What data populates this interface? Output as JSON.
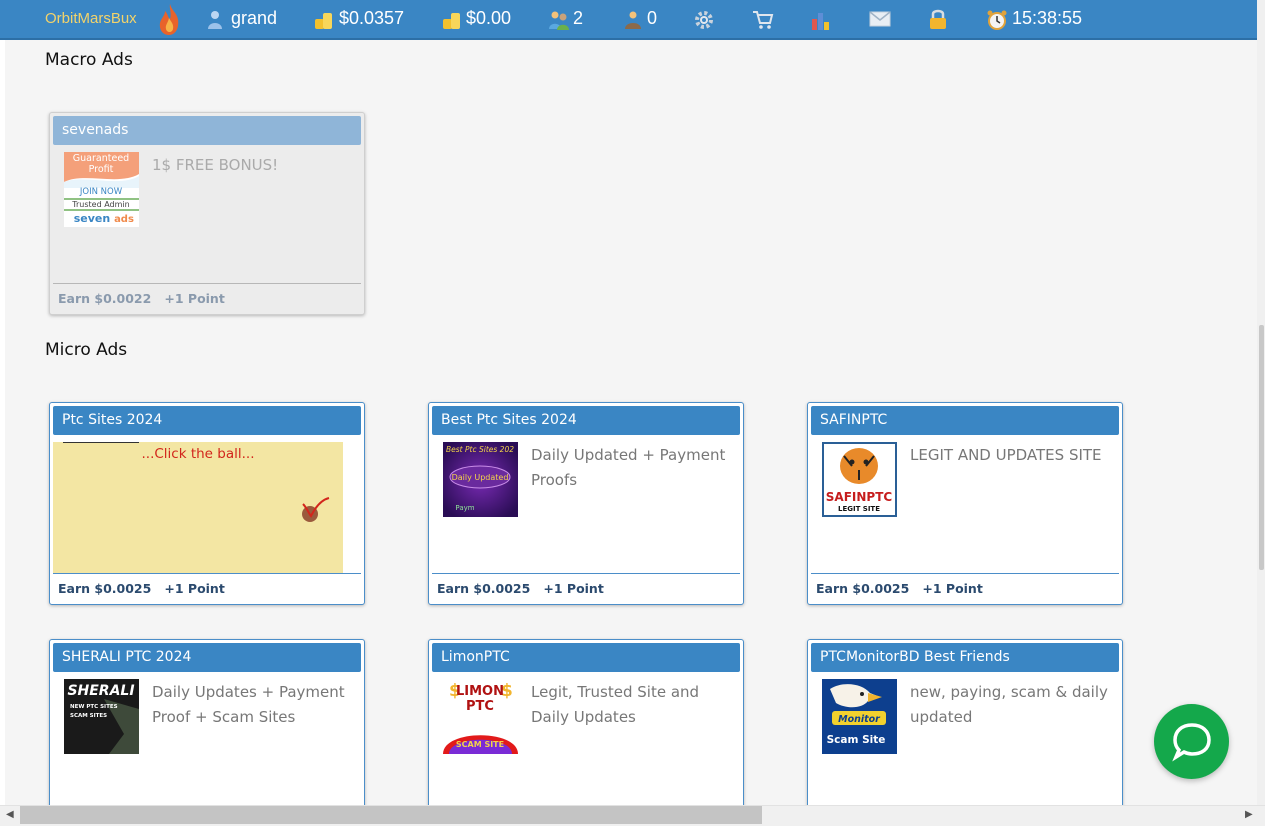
{
  "topbar": {
    "logo": "OrbitMarsBux",
    "username": "grand",
    "balance_main": "$0.0357",
    "balance_purchase": "$0.00",
    "referrals": "2",
    "rented": "0",
    "clock": "15:38:55"
  },
  "macro": {
    "title": "Macro Ads",
    "cards": [
      {
        "title": "sevenads",
        "desc": "1$ FREE BONUS!",
        "earn": "Earn $0.0022   +1 Point",
        "banner": {
          "line1": "Guaranteed",
          "line2": "Profit",
          "cta": "JOIN NOW",
          "tag": "Trusted Admin",
          "brand1": "seven",
          "brand2": "ads"
        }
      }
    ]
  },
  "micro": {
    "title": "Micro Ads",
    "captcha_text": "...Click the ball...",
    "cards": [
      {
        "title": "Ptc Sites 2024",
        "earn": "Earn $0.0025   +1 Point"
      },
      {
        "title": "Best Ptc Sites 2024",
        "desc": "Daily Updated + Payment Proofs",
        "earn": "Earn $0.0025   +1 Point",
        "thumb": {
          "line1": "Best Ptc Sites 202",
          "line2": "Daily Updated",
          "line3": "Paym"
        }
      },
      {
        "title": "SAFINPTC",
        "desc": "LEGIT AND UPDATES SITE",
        "earn": "Earn $0.0025   +1 Point",
        "thumb": {
          "line1": "SAFINPTC",
          "line2": "LEGIT SITE"
        }
      },
      {
        "title": "SHERALI PTC 2024",
        "desc": "Daily Updates + Payment Proof + Scam Sites",
        "thumb": {
          "line1": "SHERALI",
          "line2": "NEW PTC SITES",
          "line3": "SCAM SITES"
        }
      },
      {
        "title": "LimonPTC",
        "desc": "Legit, Trusted Site and Daily Updates",
        "thumb": {
          "line1": "LIMON",
          "line2": "PTC",
          "line3": "SCAM SITE"
        }
      },
      {
        "title": "PTCMonitorBD Best Friends",
        "desc": "new, paying, scam & daily updated",
        "thumb": {
          "line1": "Monitor",
          "line2": "Scam Site"
        }
      }
    ]
  },
  "colors": {
    "accent": "#3a86c4",
    "chat": "#14a84b",
    "logo": "#f2d36b"
  }
}
